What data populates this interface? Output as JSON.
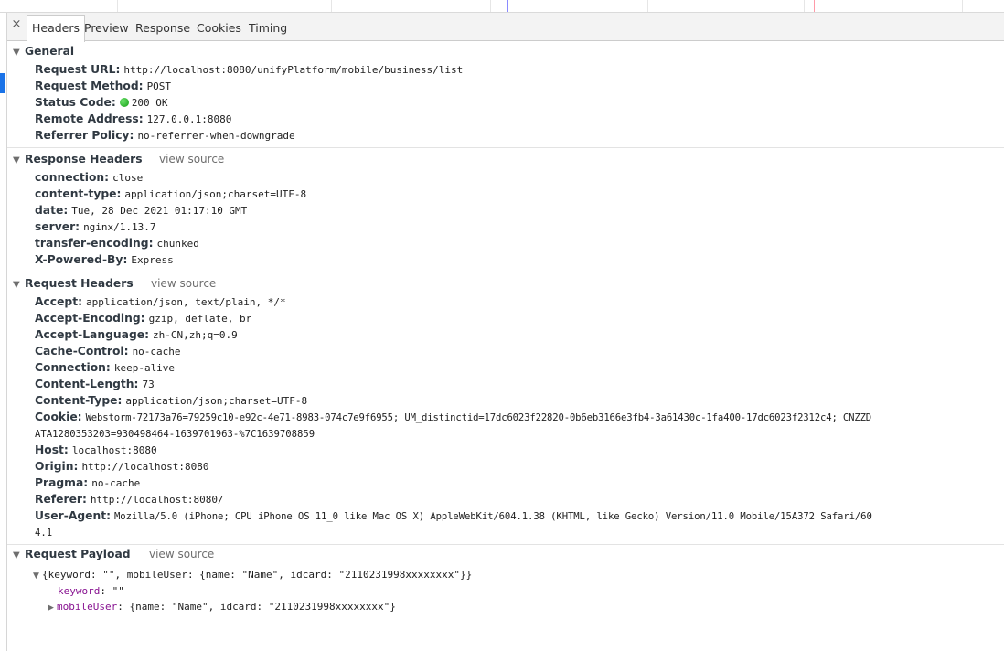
{
  "timeline": {
    "marker_colors": [
      "#8a8aff",
      "#ff9aa8"
    ]
  },
  "tabs": [
    {
      "label": "Headers",
      "active": true
    },
    {
      "label": "Preview",
      "active": false
    },
    {
      "label": "Response",
      "active": false
    },
    {
      "label": "Cookies",
      "active": false
    },
    {
      "label": "Timing",
      "active": false
    }
  ],
  "general": {
    "title": "General",
    "rows": [
      {
        "key": "Request URL:",
        "value": "http://localhost:8080/unifyPlatform/mobile/business/list"
      },
      {
        "key": "Request Method:",
        "value": "POST"
      },
      {
        "key": "Status Code:",
        "value": "200 OK",
        "status_color": "#1aa81a"
      },
      {
        "key": "Remote Address:",
        "value": "127.0.0.1:8080"
      },
      {
        "key": "Referrer Policy:",
        "value": "no-referrer-when-downgrade"
      }
    ]
  },
  "response_headers": {
    "title": "Response Headers",
    "view_source": "view source",
    "rows": [
      {
        "key": "connection:",
        "value": "close"
      },
      {
        "key": "content-type:",
        "value": "application/json;charset=UTF-8"
      },
      {
        "key": "date:",
        "value": "Tue, 28 Dec 2021 01:17:10 GMT"
      },
      {
        "key": "server:",
        "value": "nginx/1.13.7"
      },
      {
        "key": "transfer-encoding:",
        "value": "chunked"
      },
      {
        "key": "X-Powered-By:",
        "value": "Express"
      }
    ]
  },
  "request_headers": {
    "title": "Request Headers",
    "view_source": "view source",
    "rows": [
      {
        "key": "Accept:",
        "value": "application/json, text/plain, */*"
      },
      {
        "key": "Accept-Encoding:",
        "value": "gzip, deflate, br"
      },
      {
        "key": "Accept-Language:",
        "value": "zh-CN,zh;q=0.9"
      },
      {
        "key": "Cache-Control:",
        "value": "no-cache"
      },
      {
        "key": "Connection:",
        "value": "keep-alive"
      },
      {
        "key": "Content-Length:",
        "value": "73"
      },
      {
        "key": "Content-Type:",
        "value": "application/json;charset=UTF-8"
      }
    ],
    "cookie": {
      "key": "Cookie:",
      "line1": "Webstorm-72173a76=79259c10-e92c-4e71-8983-074c7e9f6955; UM_distinctid=17dc6023f22820-0b6eb3166e3fb4-3a61430c-1fa400-17dc6023f2312c4; CNZZD",
      "line2": "ATA1280353203=930498464-1639701963-%7C1639708859"
    },
    "rows2": [
      {
        "key": "Host:",
        "value": "localhost:8080"
      },
      {
        "key": "Origin:",
        "value": "http://localhost:8080"
      },
      {
        "key": "Pragma:",
        "value": "no-cache"
      },
      {
        "key": "Referer:",
        "value": "http://localhost:8080/"
      }
    ],
    "user_agent": {
      "key": "User-Agent:",
      "line1": "Mozilla/5.0 (iPhone; CPU iPhone OS 11_0 like Mac OS X) AppleWebKit/604.1.38 (KHTML, like Gecko) Version/11.0 Mobile/15A372 Safari/60",
      "line2": "4.1"
    }
  },
  "request_payload": {
    "title": "Request Payload",
    "view_source": "view source",
    "summary": "{keyword: \"\", mobileUser: {name: \"Name\", idcard: \"2110231998xxxxxxxx\"}}",
    "keyword_key": "keyword",
    "keyword_value": ": \"\"",
    "mobileuser_key": "mobileUser",
    "mobileuser_value": ": {name: \"Name\", idcard: \"2110231998xxxxxxxx\"}"
  },
  "icons": {
    "close": "×",
    "expanded": "▼",
    "collapsed": "▶"
  }
}
